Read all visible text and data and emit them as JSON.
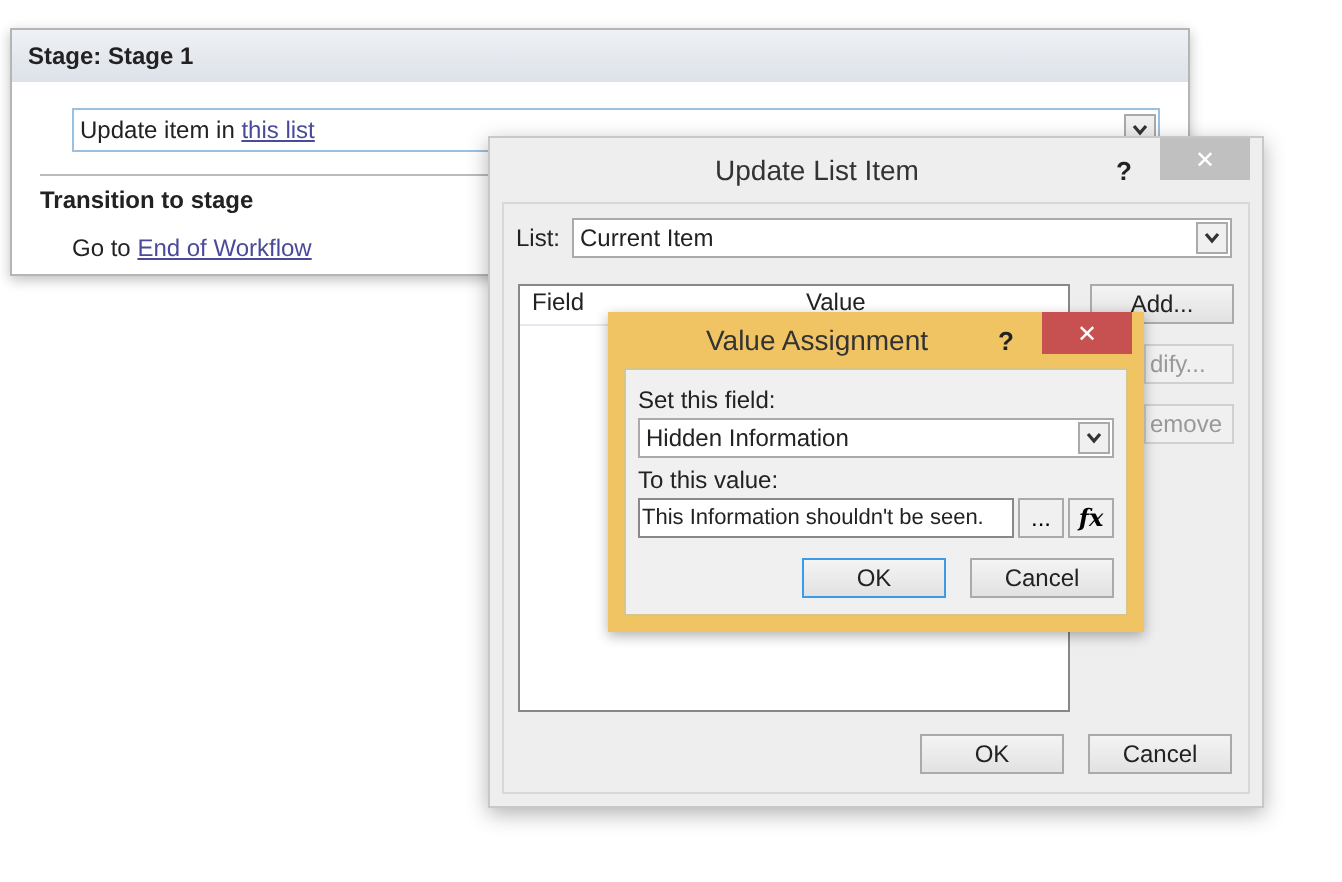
{
  "stage_window": {
    "title": "Stage: Stage 1",
    "action": {
      "text": "Update item in ",
      "link": "this list"
    },
    "transition_heading": "Transition to stage",
    "transition": {
      "text": "Go to ",
      "link": "End of Workflow"
    }
  },
  "update_dialog": {
    "title": "Update List Item",
    "help": "?",
    "close": "✕",
    "list_label": "List:",
    "list_value": "Current Item",
    "columns": [
      "Field",
      "Value"
    ],
    "side_buttons": [
      {
        "label": "Add...",
        "disabled": false
      },
      {
        "label": "dify...",
        "disabled": true
      },
      {
        "label": "emove",
        "disabled": true
      }
    ],
    "buttons": [
      "OK",
      "Cancel"
    ]
  },
  "value_dialog": {
    "title": "Value Assignment",
    "help": "?",
    "close": "✕",
    "field_label": "Set this field:",
    "field_value": "Hidden Information",
    "value_label": "To this value:",
    "value": "This Information shouldn't be seen.",
    "browse": "...",
    "formula": "fx",
    "buttons": [
      {
        "label": "OK",
        "default": true
      },
      {
        "label": "Cancel",
        "default": false
      }
    ]
  }
}
